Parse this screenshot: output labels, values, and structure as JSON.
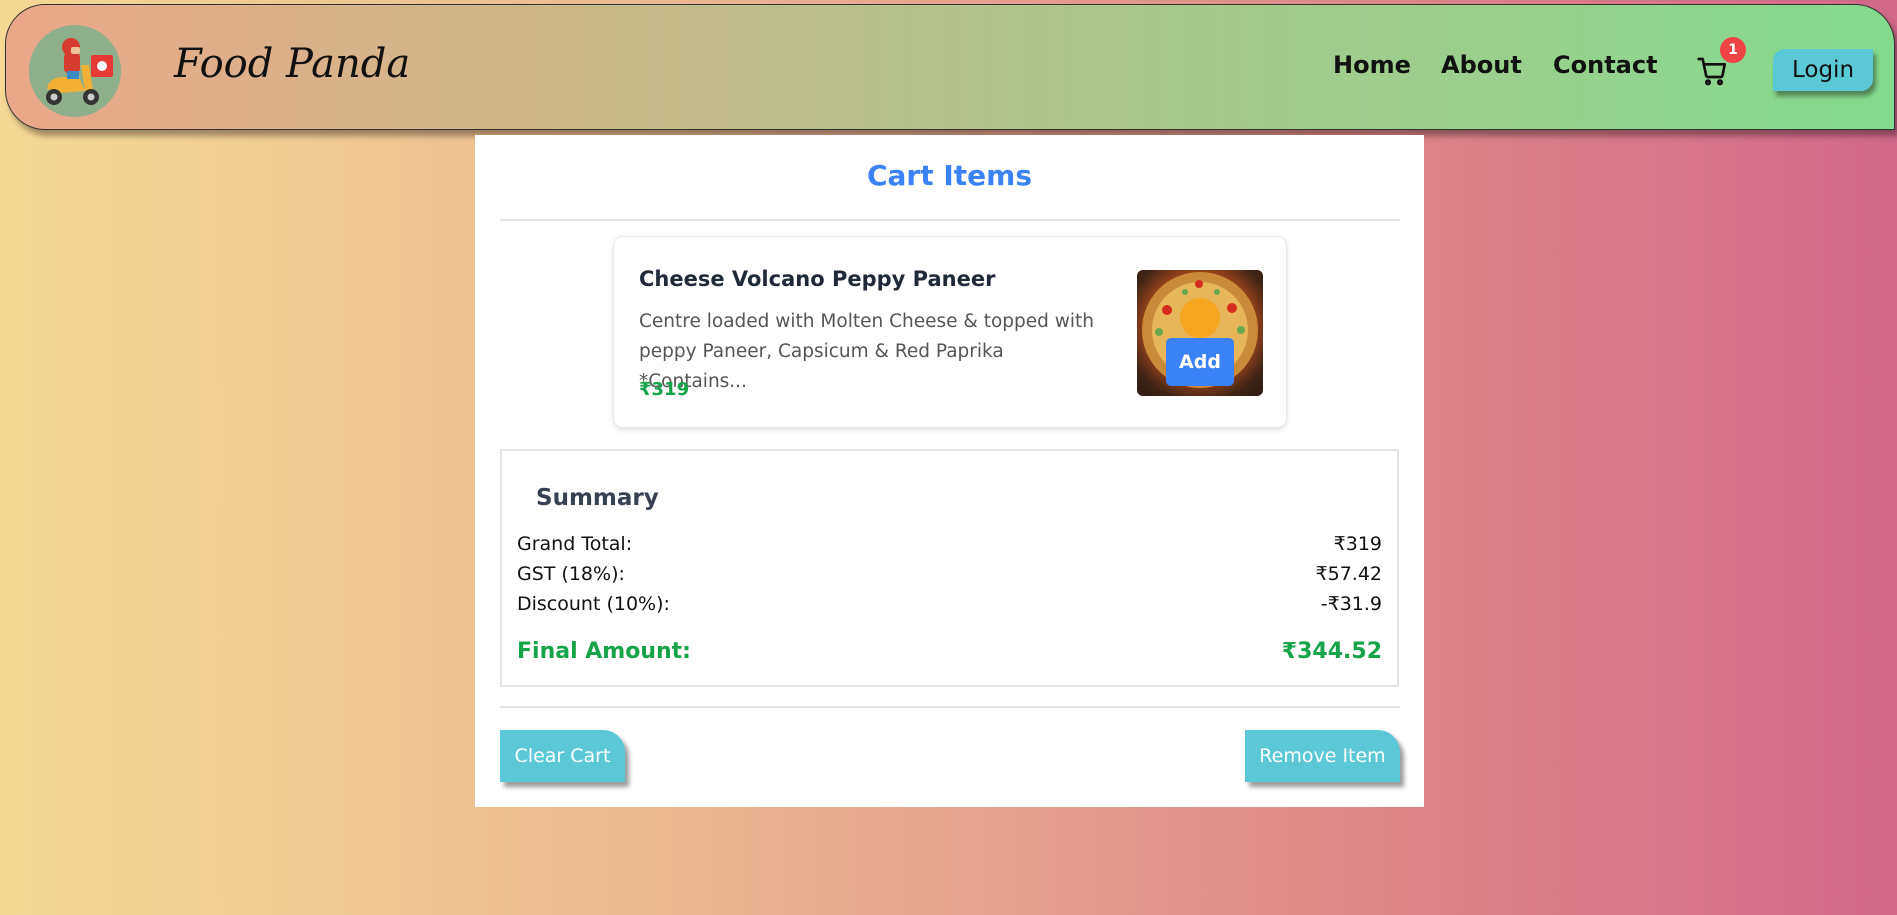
{
  "navbar": {
    "brand": "Food Panda",
    "links": [
      "Home",
      "About",
      "Contact"
    ],
    "cart_count": "1",
    "login_label": "Login"
  },
  "cart": {
    "title": "Cart Items",
    "items": [
      {
        "name": "Cheese Volcano Peppy Paneer",
        "description": "Centre loaded with Molten Cheese & topped with peppy Paneer, Capsicum & Red Paprika *Contains...",
        "price": "₹319",
        "add_label": "Add"
      }
    ]
  },
  "summary": {
    "title": "Summary",
    "grand_total_label": "Grand Total:",
    "grand_total_value": "₹319",
    "gst_label": "GST (18%):",
    "gst_value": "₹57.42",
    "discount_label": "Discount (10%):",
    "discount_value": "-₹31.9",
    "final_label": "Final Amount:",
    "final_value": "₹344.52"
  },
  "actions": {
    "clear_label": "Clear Cart",
    "remove_label": "Remove Item"
  },
  "colors": {
    "accent_blue": "#3b82f6",
    "price_green": "#16a34a",
    "button_teal": "#5bc8d8",
    "badge_red": "#ef4444"
  }
}
